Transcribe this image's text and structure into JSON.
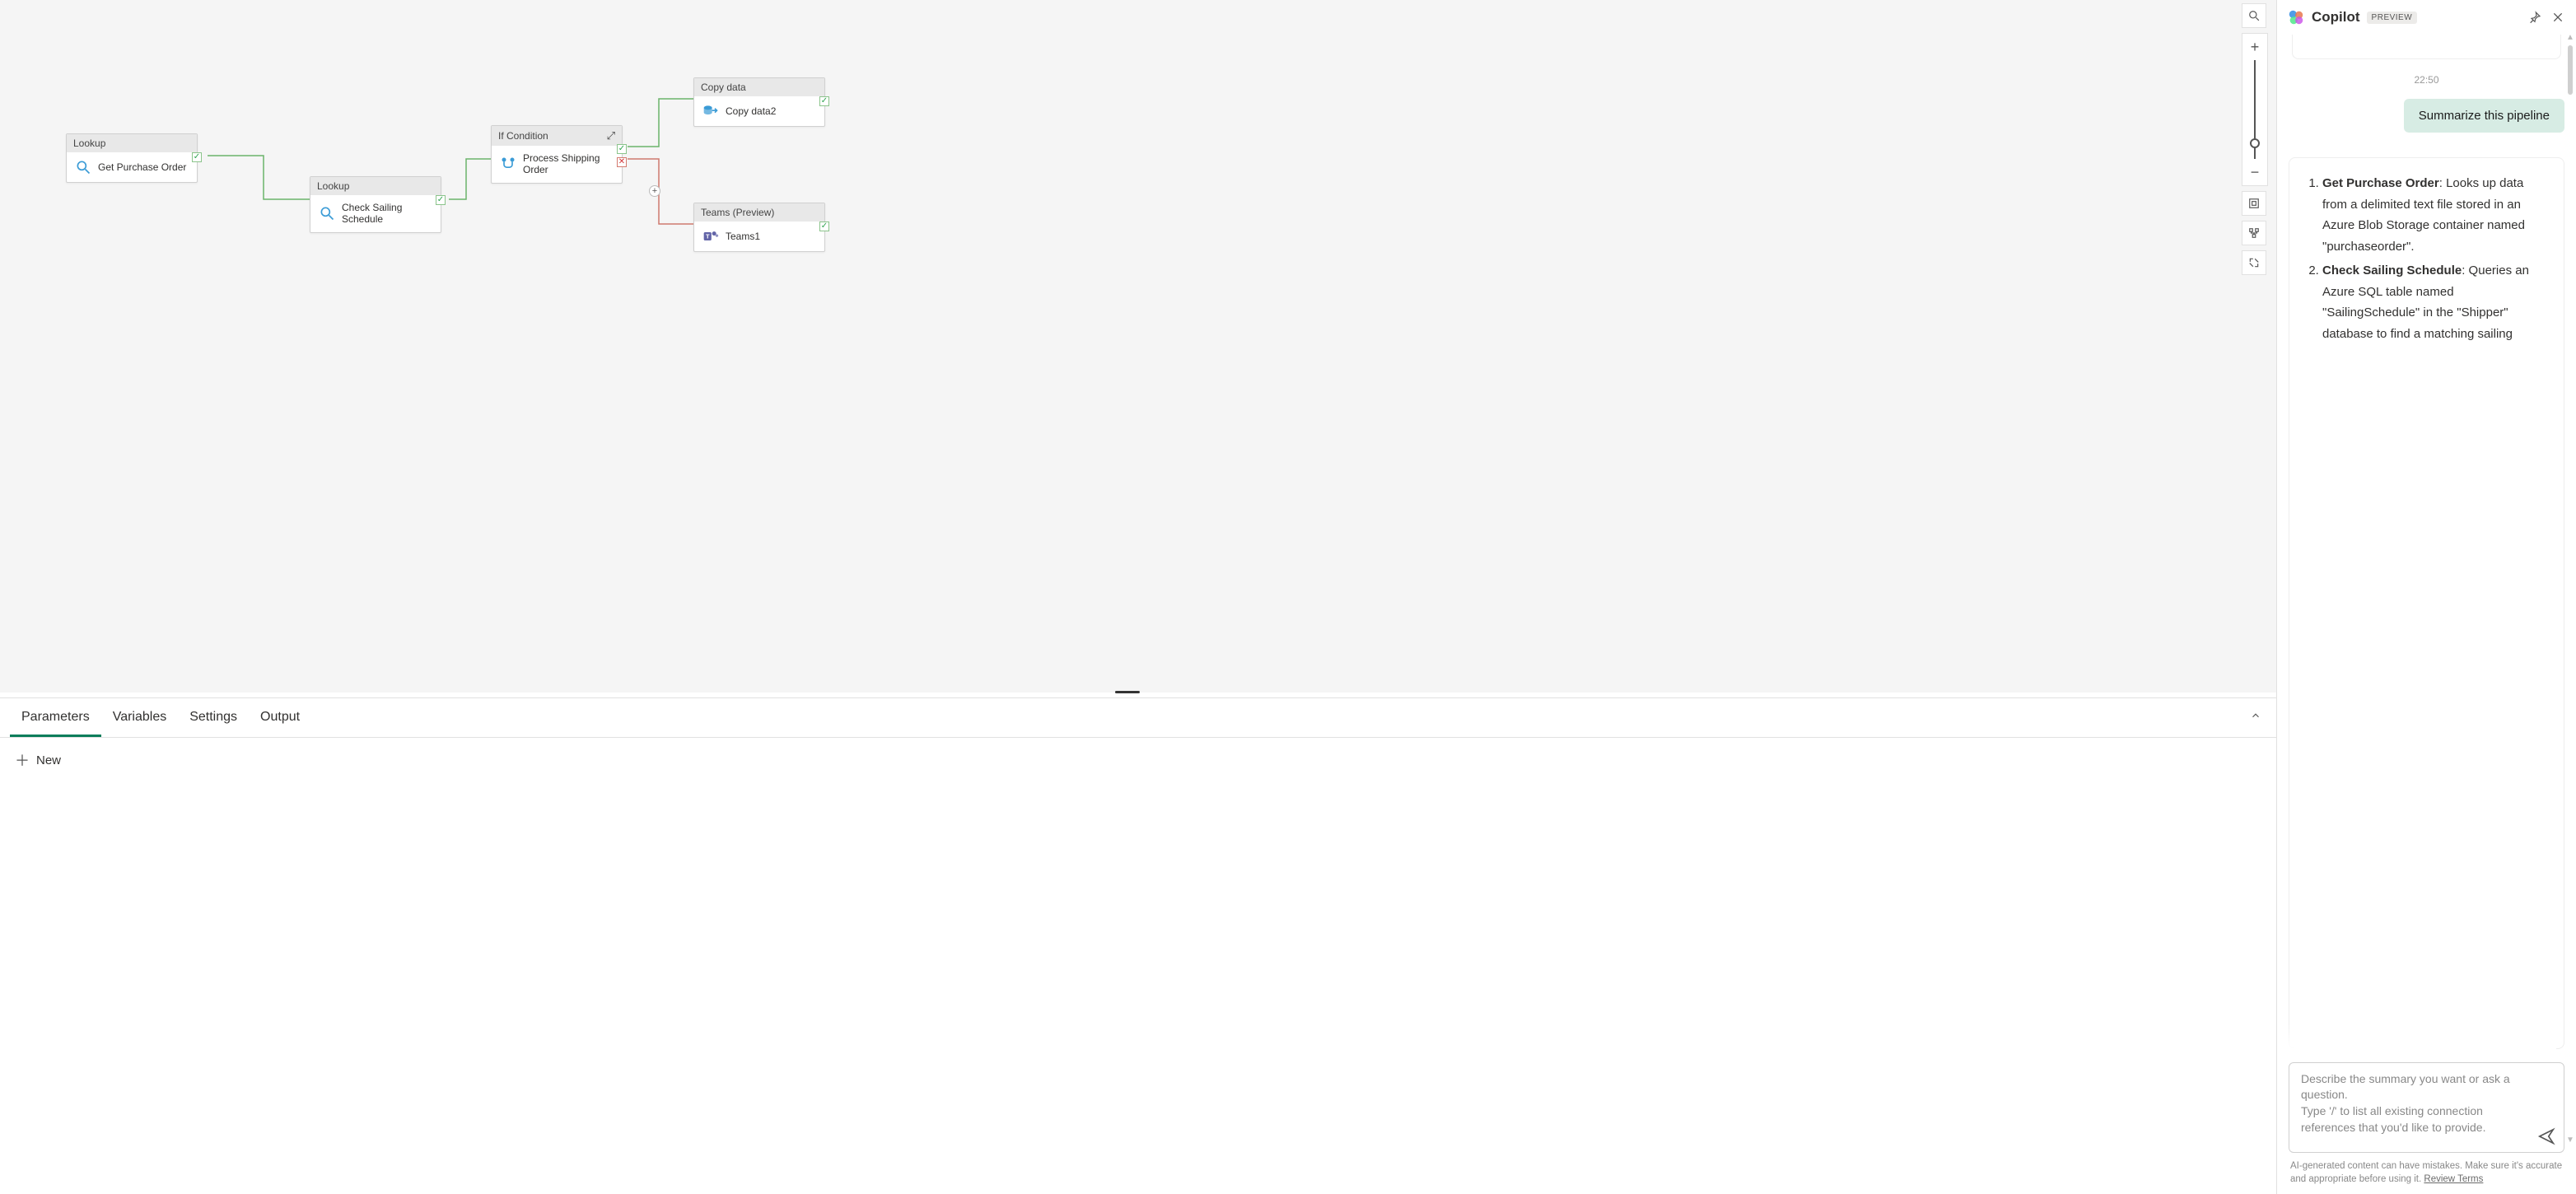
{
  "canvas": {
    "tools": {
      "search": "search-icon",
      "zoom_in": "+",
      "zoom_out": "−",
      "fit": "fit-to-screen",
      "layout": "auto-layout",
      "fullscreen": "fullscreen"
    },
    "nodes": {
      "n1": {
        "type": "Lookup",
        "label": "Get Purchase Order"
      },
      "n2": {
        "type": "Lookup",
        "label": "Check Sailing Schedule"
      },
      "n3": {
        "type": "If Condition",
        "label": "Process Shipping Order"
      },
      "n4": {
        "type": "Copy data",
        "label": "Copy data2"
      },
      "n5": {
        "type": "Teams (Preview)",
        "label": "Teams1"
      }
    },
    "status": {
      "ok": "✓",
      "fail": "✕",
      "add": "+"
    }
  },
  "props": {
    "tabs": [
      "Parameters",
      "Variables",
      "Settings",
      "Output"
    ],
    "active_tab": 0,
    "new_label": "New"
  },
  "copilot": {
    "title": "Copilot",
    "badge": "PREVIEW",
    "timestamp": "22:50",
    "user_message": "Summarize this pipeline",
    "answer": {
      "item1_title": "Get Purchase Order",
      "item1_body": ": Looks up data from a delimited text file stored in an Azure Blob Storage container named \"purchaseorder\".",
      "item2_title": "Check Sailing Schedule",
      "item2_body": ": Queries an Azure SQL table named \"SailingSchedule\" in the \"Shipper\" database to find a matching sailing"
    },
    "input_placeholder": "Describe the summary you want or ask a question.\nType '/' to list all existing connection references that you'd like to provide.",
    "footer_text": "AI-generated content can have mistakes. Make sure it's accurate and appropriate before using it. ",
    "footer_link": "Review Terms"
  }
}
